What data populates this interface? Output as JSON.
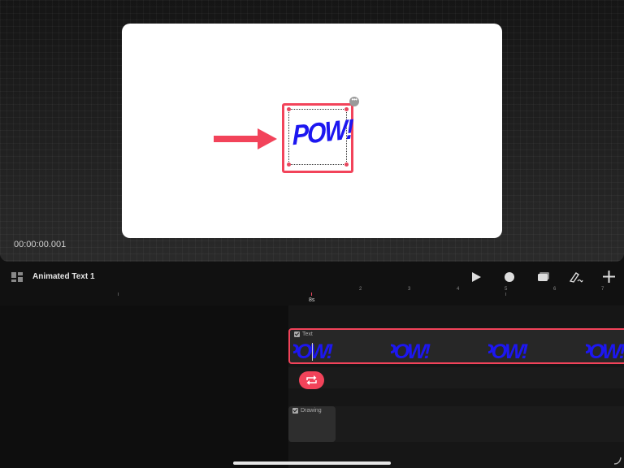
{
  "stage": {
    "timecode": "00:00:00.001",
    "canvas_text": "POW!",
    "more_glyph": "•••"
  },
  "toolbar": {
    "project_title": "Animated Text 1",
    "icons": [
      "layout-icon",
      "play-icon",
      "record-icon",
      "layers-icon",
      "draw-icon",
      "add-icon"
    ]
  },
  "ruler": {
    "ticks": [
      "1",
      "2",
      "3",
      "4",
      "5",
      "6",
      "7"
    ],
    "playhead_label": "8s"
  },
  "tracks": {
    "text_clip_label": "Text",
    "text_clip_thumb": "POW!",
    "drawing_clip_label": "Drawing"
  },
  "colors": {
    "accent": "#f2435a",
    "pow_blue": "#1d17f0",
    "canvas_bg": "#ffffff"
  }
}
